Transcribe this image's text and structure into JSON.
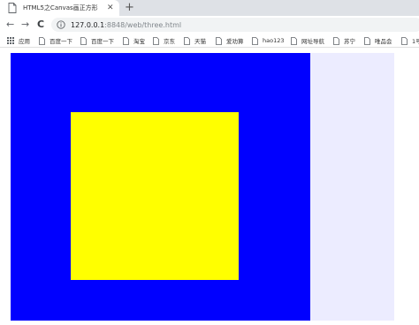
{
  "tab": {
    "title": "HTML5之Canvas画正方形",
    "close": "✕",
    "new_tab": "+"
  },
  "toolbar": {
    "back": "←",
    "forward": "→",
    "reload": "C",
    "url_host": "127.0.0.1",
    "url_path": ":8848/web/three.html"
  },
  "bookmarks": [
    {
      "label": "应用",
      "icon": "apps-icon"
    },
    {
      "label": "百度一下",
      "icon": "page-icon"
    },
    {
      "label": "百度一下",
      "icon": "page-icon"
    },
    {
      "label": "淘宝",
      "icon": "page-icon"
    },
    {
      "label": "京东",
      "icon": "page-icon"
    },
    {
      "label": "天猫",
      "icon": "page-icon"
    },
    {
      "label": "爱劝算",
      "icon": "page-icon"
    },
    {
      "label": "hao123",
      "icon": "page-icon"
    },
    {
      "label": "网址导航",
      "icon": "page-icon"
    },
    {
      "label": "苏宁",
      "icon": "page-icon"
    },
    {
      "label": "唯品会",
      "icon": "page-icon"
    },
    {
      "label": "1号",
      "icon": "page-icon"
    }
  ],
  "canvas": {
    "background_color": "#ececff",
    "outer_rect_color": "#0000ff",
    "inner_square_color": "#ffff00"
  }
}
